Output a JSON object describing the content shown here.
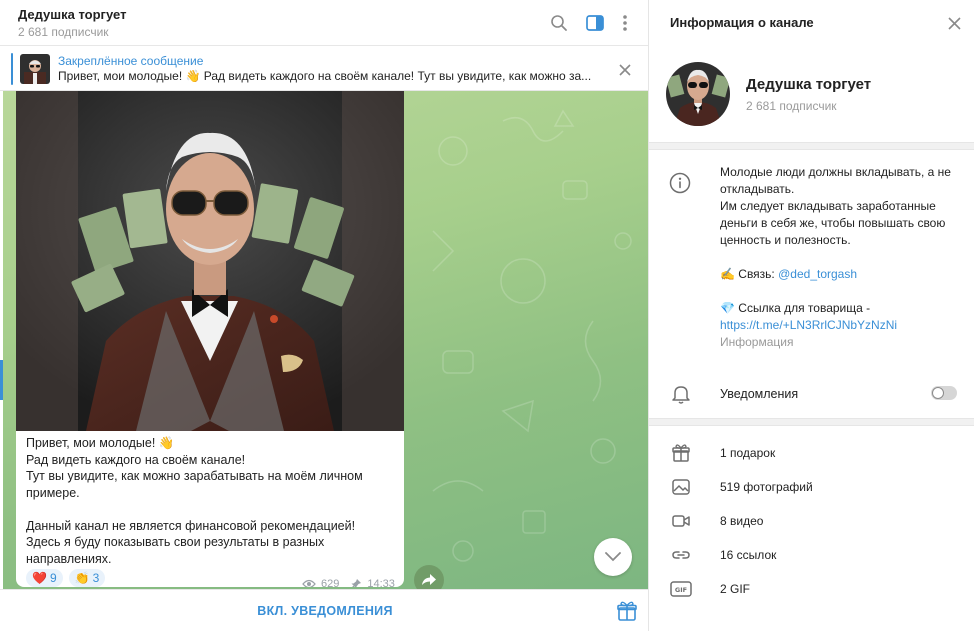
{
  "chat": {
    "title": "Дедушка торгует",
    "subscribers": "2 681 подписчик"
  },
  "pinned": {
    "title": "Закреплённое сообщение",
    "text": "Привет, мои молодые! 👋 Рад видеть каждого на своём канале!  Тут вы увидите, как можно за..."
  },
  "message": {
    "lines": [
      "Привет, мои молодые! 👋",
      "Рад видеть каждого на своём канале!",
      "Тут вы увидите, как можно зарабатывать на моём личном примере.",
      "",
      "Данный канал не является финансовой рекомендацией!",
      "Здесь я буду показывать свои результаты в разных направлениях."
    ],
    "reactions": [
      {
        "emoji": "❤️",
        "count": "9"
      },
      {
        "emoji": "👏",
        "count": "3"
      }
    ],
    "views": "629",
    "time": "14:33"
  },
  "bottom": {
    "unmute_label": "ВКЛ. УВЕДОМЛЕНИЯ"
  },
  "info": {
    "title": "Информация о канале",
    "name": "Дедушка торгует",
    "subscribers": "2 681 подписчик",
    "about_lines": [
      "Молодые люди должны вкладывать, а не откладывать.",
      "Им следует вкладывать заработанные деньги в себя же, чтобы повышать свою ценность и полезность."
    ],
    "contact_prefix": "✍️ Связь: ",
    "contact_link": "@ded_torgash",
    "friend_prefix": "💎 Ссылка для товарища -",
    "friend_link": "https://t.me/+LN3RrlCJNbYzNzNi",
    "about_caption": "Информация",
    "notifications_label": "Уведомления",
    "notifications_on": false,
    "media": [
      {
        "icon": "gift-icon",
        "label": "1 подарок"
      },
      {
        "icon": "photo-icon",
        "label": "519 фотографий"
      },
      {
        "icon": "video-icon",
        "label": "8 видео"
      },
      {
        "icon": "link-icon",
        "label": "16 ссылок"
      },
      {
        "icon": "gif-icon",
        "label": "2 GIF"
      }
    ]
  },
  "colors": {
    "accent": "#3a8fd6",
    "chat_bg": "#a7cf8c"
  }
}
